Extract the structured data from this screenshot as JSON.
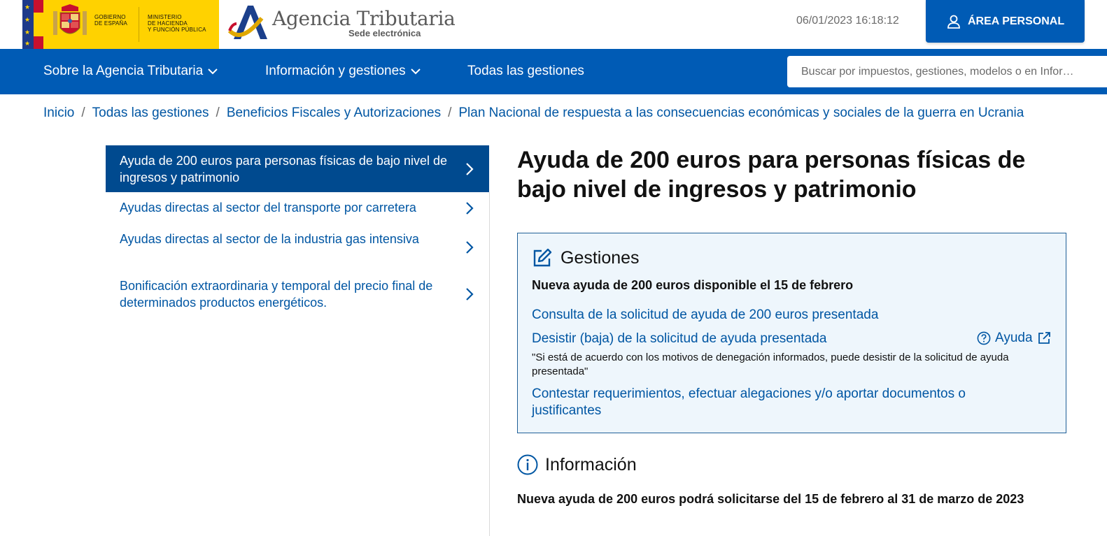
{
  "header": {
    "gov_line1": "GOBIERNO",
    "gov_line2": "DE ESPAÑA",
    "ministry_line1": "MINISTERIO",
    "ministry_line2": "DE HACIENDA",
    "ministry_line3": "Y FUNCIÓN PÚBLICA",
    "brand_name": "Agencia Tributaria",
    "brand_sub": "Sede electrónica",
    "datetime": "06/01/2023 16:18:12",
    "area_personal_label": "ÁREA PERSONAL"
  },
  "nav": {
    "items": [
      {
        "label": "Sobre la Agencia Tributaria",
        "has_dropdown": true
      },
      {
        "label": "Información y gestiones",
        "has_dropdown": true
      },
      {
        "label": "Todas las gestiones",
        "has_dropdown": false
      }
    ],
    "search_placeholder": "Buscar por impuestos, gestiones, modelos o en Infor…"
  },
  "breadcrumb": [
    "Inicio",
    "Todas las gestiones",
    "Beneficios Fiscales y Autorizaciones",
    "Plan Nacional de respuesta a las consecuencias económicas y sociales de la guerra en Ucrania"
  ],
  "sidebar": {
    "items": [
      {
        "label": "Ayuda de 200 euros para personas físicas de bajo nivel de ingresos y patrimonio",
        "active": true
      },
      {
        "label": "Ayudas directas al sector del transporte por carretera",
        "active": false
      },
      {
        "label": "Ayudas directas al sector de la industria gas intensiva",
        "active": false
      },
      {
        "label": "Bonificación extraordinaria y temporal del precio final de determinados productos energéticos.",
        "active": false
      }
    ]
  },
  "main": {
    "title": "Ayuda de 200 euros para personas físicas de bajo nivel de ingresos y patrimonio",
    "gestiones": {
      "heading": "Gestiones",
      "subtitle": "Nueva ayuda de 200 euros disponible el 15 de febrero",
      "link_consulta": "Consulta de la solicitud de ayuda de 200 euros presentada",
      "link_desistir": "Desistir (baja) de la solicitud de ayuda presentada",
      "help_label": "Ayuda",
      "note": "\"Si está de acuerdo con los motivos de denegación informados, puede desistir de la solicitud de ayuda presentada\"",
      "link_contestar": "Contestar requerimientos, efectuar alegaciones y/o aportar documentos o justificantes"
    },
    "informacion": {
      "heading": "Información",
      "text": "Nueva ayuda de 200 euros podrá solicitarse del 15 de febrero al 31 de marzo de 2023"
    }
  },
  "colors": {
    "primary_blue": "#005bb5",
    "active_sidebar": "#004a8f",
    "link_blue": "#0056a3",
    "gov_yellow": "#ffd200",
    "box_bg": "#eef6fc"
  },
  "icons": [
    "user-icon",
    "chevron-down-icon",
    "chevron-right-icon",
    "edit-icon",
    "question-circle-icon",
    "external-link-icon",
    "info-circle-icon"
  ]
}
